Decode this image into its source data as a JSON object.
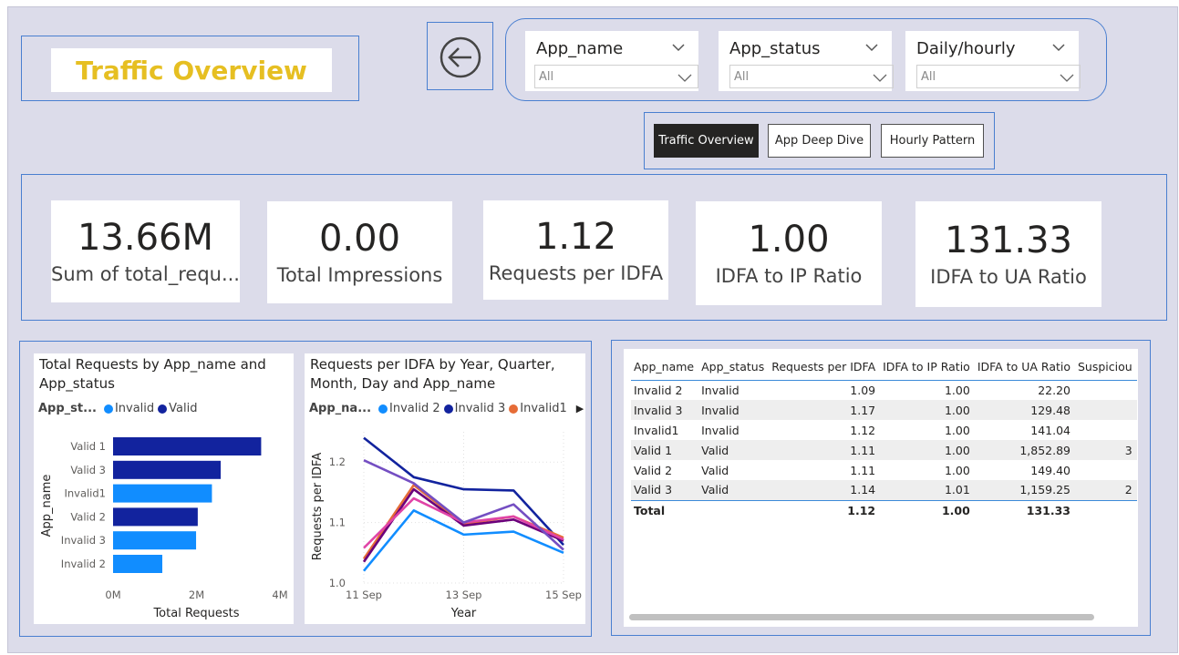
{
  "page_title": "Traffic Overview",
  "slicers": [
    {
      "label": "App_name",
      "value": "All"
    },
    {
      "label": "App_status",
      "value": "All"
    },
    {
      "label": "Daily/hourly",
      "value": "All"
    }
  ],
  "nav": [
    {
      "label": "Traffic Overview",
      "active": true
    },
    {
      "label": "App Deep Dive",
      "active": false
    },
    {
      "label": "Hourly Pattern",
      "active": false
    }
  ],
  "kpis": [
    {
      "value": "13.66M",
      "caption": "Sum of total_requ..."
    },
    {
      "value": "0.00",
      "caption": "Total Impressions"
    },
    {
      "value": "1.12",
      "caption": "Requests per IDFA"
    },
    {
      "value": "1.00",
      "caption": "IDFA to IP Ratio"
    },
    {
      "value": "131.33",
      "caption": "IDFA to UA Ratio"
    }
  ],
  "bar_chart": {
    "title_line1": "Total Requests by App_name and",
    "title_line2": "App_status",
    "legend_title": "App_st...",
    "legend": [
      {
        "name": "Invalid",
        "color": "#118dff"
      },
      {
        "name": "Valid",
        "color": "#12239e"
      }
    ]
  },
  "line_chart": {
    "title_line1": "Requests per IDFA by Year, Quarter,",
    "title_line2": "Month, Day and App_name",
    "legend_title": "App_na...",
    "legend": [
      {
        "name": "Invalid 2",
        "color": "#118dff"
      },
      {
        "name": "Invalid 3",
        "color": "#12239e"
      },
      {
        "name": "Invalid1",
        "color": "#e66c37"
      }
    ],
    "legend_arrow": "▶"
  },
  "chart_data": [
    {
      "type": "bar",
      "orientation": "horizontal",
      "title": "Total Requests by App_name and App_status",
      "xlabel": "Total Requests",
      "ylabel": "App_name",
      "xlim": [
        0,
        4000000
      ],
      "x_ticks": [
        "0M",
        "2M",
        "4M"
      ],
      "categories": [
        "Valid 1",
        "Valid 3",
        "Invalid1",
        "Valid 2",
        "Invalid 3",
        "Invalid 2"
      ],
      "values": [
        3550000,
        2580000,
        2370000,
        2030000,
        1990000,
        1180000
      ],
      "status": [
        "Valid",
        "Valid",
        "Invalid",
        "Valid",
        "Invalid",
        "Invalid"
      ],
      "series": [
        {
          "name": "Invalid",
          "color": "#118dff"
        },
        {
          "name": "Valid",
          "color": "#12239e"
        }
      ]
    },
    {
      "type": "line",
      "title": "Requests per IDFA by Year, Quarter, Month, Day and App_name",
      "xlabel": "Year",
      "ylabel": "Requests per IDFA",
      "x": [
        "11 Sep",
        "12 Sep",
        "13 Sep",
        "14 Sep",
        "15 Sep"
      ],
      "x_ticks": [
        "11 Sep",
        "13 Sep",
        "15 Sep"
      ],
      "ylim": [
        1.0,
        1.25
      ],
      "y_ticks": [
        "1.0",
        "1.1",
        "1.2"
      ],
      "series": [
        {
          "name": "Invalid 2",
          "color": "#118dff",
          "values": [
            1.02,
            1.12,
            1.08,
            1.085,
            1.05
          ]
        },
        {
          "name": "Invalid 3",
          "color": "#12239e",
          "values": [
            1.24,
            1.175,
            1.155,
            1.153,
            1.063
          ]
        },
        {
          "name": "Invalid1",
          "color": "#e66c37",
          "values": [
            1.04,
            1.162,
            1.098,
            1.11,
            1.075
          ]
        },
        {
          "name": "",
          "color": "#6b007b",
          "values": [
            1.035,
            1.155,
            1.095,
            1.105,
            1.07
          ]
        },
        {
          "name": "",
          "color": "#e044a7",
          "values": [
            1.058,
            1.14,
            1.1,
            1.11,
            1.072
          ]
        },
        {
          "name": "",
          "color": "#744ec2",
          "values": [
            1.203,
            1.165,
            1.1,
            1.13,
            1.055
          ]
        }
      ]
    }
  ],
  "table": {
    "columns": [
      "App_name",
      "App_status",
      "Requests per IDFA",
      "IDFA to IP Ratio",
      "IDFA to UA Ratio",
      "Suspiciou"
    ],
    "rows": [
      [
        "Invalid 2",
        "Invalid",
        "1.09",
        "1.00",
        "22.20",
        ""
      ],
      [
        "Invalid 3",
        "Invalid",
        "1.17",
        "1.00",
        "129.48",
        ""
      ],
      [
        "Invalid1",
        "Invalid",
        "1.12",
        "1.00",
        "141.04",
        ""
      ],
      [
        "Valid 1",
        "Valid",
        "1.11",
        "1.00",
        "1,852.89",
        "3"
      ],
      [
        "Valid 2",
        "Valid",
        "1.11",
        "1.00",
        "149.40",
        ""
      ],
      [
        "Valid 3",
        "Valid",
        "1.14",
        "1.01",
        "1,159.25",
        "2"
      ]
    ],
    "total": [
      "Total",
      "",
      "1.12",
      "1.00",
      "131.33",
      ""
    ]
  }
}
